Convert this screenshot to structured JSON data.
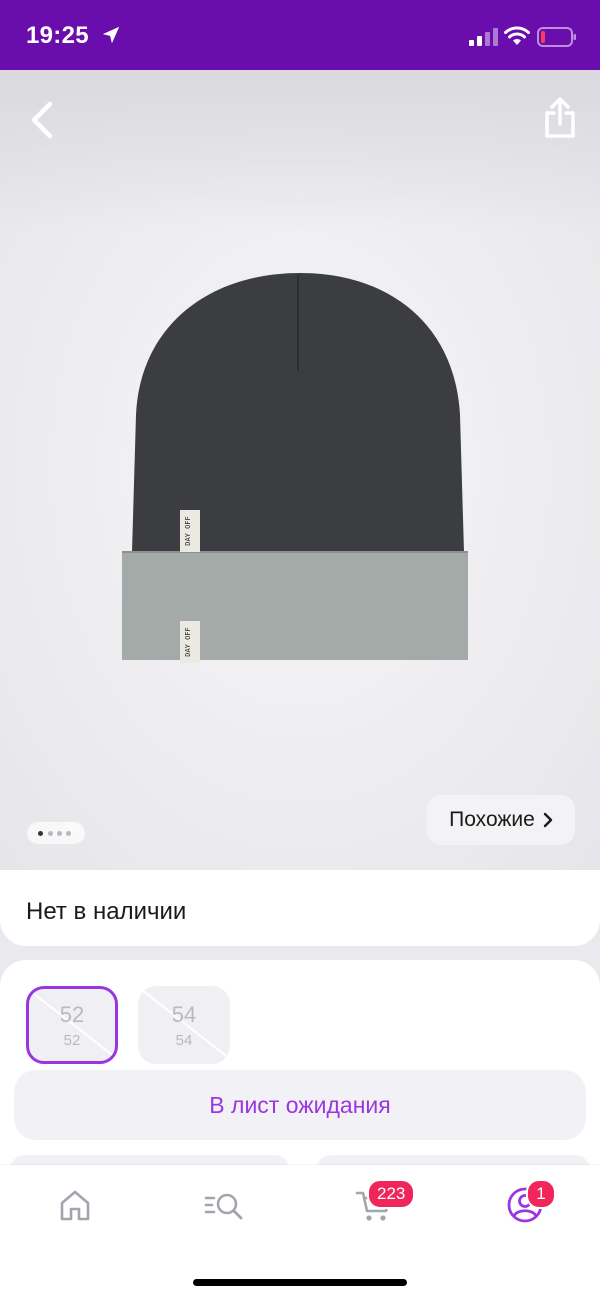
{
  "status_bar": {
    "time": "19:25"
  },
  "gallery": {
    "similar_label": "Похожие",
    "pages": 4,
    "active_page": 1,
    "hat_tag_text": "DAY OFF"
  },
  "availability": {
    "text": "Нет в наличии"
  },
  "sizes": [
    {
      "label": "52",
      "sub": "52",
      "selected": true,
      "available": false
    },
    {
      "label": "54",
      "sub": "54",
      "selected": false,
      "available": false
    }
  ],
  "waitlist_button": "В лист ожидания",
  "bottom_nav": {
    "cart_badge": "223",
    "profile_badge": "1"
  },
  "colors": {
    "brand": "#6a0dad",
    "accent": "#9b35e0",
    "badge": "#f0265a"
  }
}
